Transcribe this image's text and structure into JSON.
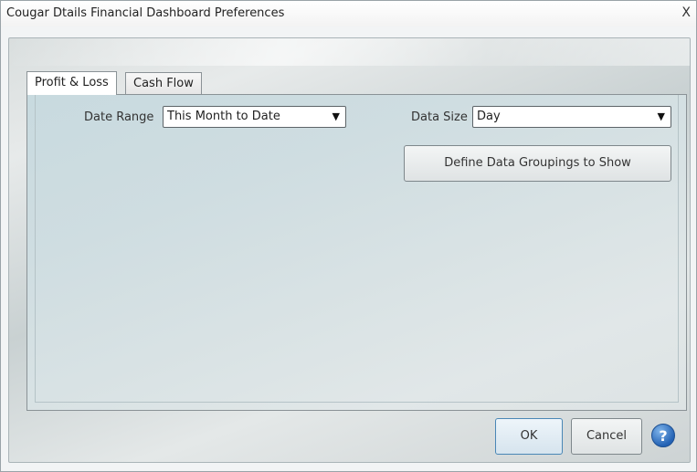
{
  "window": {
    "title": "Cougar Dtails Financial Dashboard Preferences",
    "close_label": "X"
  },
  "tabs": [
    {
      "label": "Profit & Loss",
      "selected": true
    },
    {
      "label": "Cash Flow",
      "selected": false
    }
  ],
  "settings": {
    "date_range": {
      "label": "Date Range",
      "value": "This Month to Date"
    },
    "data_size": {
      "label": "Data Size",
      "value": "Day"
    },
    "define_groupings_label": "Define Data Groupings to Show"
  },
  "footer": {
    "ok_label": "OK",
    "cancel_label": "Cancel",
    "help_glyph": "?"
  },
  "icons": {
    "dropdown": "chevron-down-icon",
    "help": "help-icon"
  },
  "colors": {
    "help_blue": "#2463b5",
    "ok_border": "#4a87b6"
  }
}
